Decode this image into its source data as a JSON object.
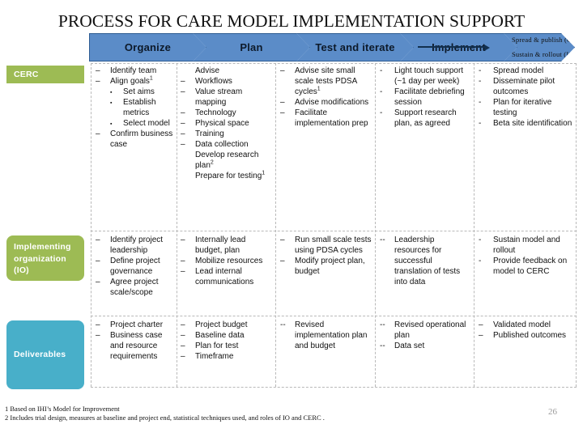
{
  "slide": {
    "title": "PROCESS FOR CARE MODEL IMPLEMENTATION SUPPORT",
    "page_number": "26"
  },
  "colors": {
    "chevron_fill": "#5b8cc8",
    "chevron_border": "#2f5d93",
    "row_green": "#9dbb54",
    "row_teal": "#48afc9",
    "separator": "#b9b9b9"
  },
  "phases": [
    {
      "label": "Organize"
    },
    {
      "label": "Plan"
    },
    {
      "label": "Test and iterate"
    },
    {
      "label": "Implement"
    },
    {
      "label_top": "Spread & publish (CERC)",
      "label_bottom": "Sustain & rollout (IO)"
    }
  ],
  "rows": [
    {
      "label": "CERC",
      "cells": [
        {
          "items": [
            {
              "marker": "–",
              "text": "Identify  team"
            },
            {
              "marker": "–",
              "text": "Align goals",
              "sup": "1"
            },
            {
              "marker": "▪",
              "level": 2,
              "text": "Set aims"
            },
            {
              "marker": "▪",
              "level": 2,
              "text": "Establish metrics"
            },
            {
              "marker": "▪",
              "level": 2,
              "text": "Select model"
            },
            {
              "marker": "–",
              "text": "Confirm business case"
            }
          ]
        },
        {
          "items": [
            {
              "marker": "",
              "level": 0,
              "text": "Advise"
            },
            {
              "marker": "–",
              "text": "Workflows"
            },
            {
              "marker": "–",
              "text": "Value stream mapping"
            },
            {
              "marker": "–",
              "text": "Technology"
            },
            {
              "marker": "–",
              "text": "Physical space"
            },
            {
              "marker": "–",
              "text": "Training"
            },
            {
              "marker": "–",
              "text": "Data collection"
            },
            {
              "marker": "",
              "level": 0,
              "text": "Develop research plan",
              "sup": "2"
            },
            {
              "marker": "",
              "level": 0,
              "text": "Prepare for testing",
              "sup": "1"
            }
          ]
        },
        {
          "items": [
            {
              "marker": "–",
              "text": "Advise site small scale tests  PDSA cycles",
              "sup": "1"
            },
            {
              "marker": "–",
              "text": "Advise modifications"
            },
            {
              "marker": "–",
              "text": "Facilitate implementation prep"
            }
          ]
        },
        {
          "items": [
            {
              "marker": "-",
              "text": "Light touch support (~1 day per week)"
            },
            {
              "marker": "-",
              "text": "Facilitate debriefing session"
            },
            {
              "marker": "-",
              "text": "Support research plan, as agreed"
            }
          ]
        },
        {
          "items": [
            {
              "marker": "-",
              "text": "Spread model"
            },
            {
              "marker": "-",
              "text": "Disseminate pilot outcomes"
            },
            {
              "marker": "-",
              "text": "Plan for iterative testing"
            },
            {
              "marker": "-",
              "text": "Beta site identification"
            }
          ]
        }
      ]
    },
    {
      "label": "Implementing organization (IO)",
      "cells": [
        {
          "items": [
            {
              "marker": "–",
              "text": "Identify project leadership"
            },
            {
              "marker": "–",
              "text": "Define project governance"
            },
            {
              "marker": "–",
              "text": "Agree project scale/scope"
            }
          ]
        },
        {
          "items": [
            {
              "marker": "–",
              "text": "Internally lead budget, plan"
            },
            {
              "marker": "–",
              "text": "Mobilize resources"
            },
            {
              "marker": "–",
              "text": "Lead internal communications"
            }
          ]
        },
        {
          "items": [
            {
              "marker": "–",
              "text": "Run small scale tests using PDSA cycles"
            },
            {
              "marker": "–",
              "text": "Modify project plan, budget"
            }
          ]
        },
        {
          "items": [
            {
              "marker": "--",
              "text": "Leadership resources for successful translation of tests into data"
            }
          ]
        },
        {
          "items": [
            {
              "marker": "-",
              "text": "Sustain model and rollout"
            },
            {
              "marker": "-",
              "text": "Provide feedback on model to CERC"
            }
          ]
        }
      ]
    },
    {
      "label": "Deliverables",
      "cells": [
        {
          "items": [
            {
              "marker": "–",
              "text": "Project charter"
            },
            {
              "marker": "–",
              "text": "Business case and resource requirements"
            }
          ]
        },
        {
          "items": [
            {
              "marker": "–",
              "text": "Project  budget"
            },
            {
              "marker": "–",
              "text": "Baseline data"
            },
            {
              "marker": "–",
              "text": "Plan for test"
            },
            {
              "marker": "–",
              "text": "Timeframe"
            }
          ]
        },
        {
          "items": [
            {
              "marker": "--",
              "text": "Revised implementation plan and budget"
            }
          ]
        },
        {
          "items": [
            {
              "marker": "--",
              "text": "Revised operational plan"
            },
            {
              "marker": "--",
              "text": "Data set"
            }
          ]
        },
        {
          "items": [
            {
              "marker": "–",
              "text": "Validated model"
            },
            {
              "marker": "–",
              "text": "Published outcomes"
            }
          ]
        }
      ]
    }
  ],
  "footnotes": [
    "1 Based on IHI’s Model for Improvement",
    "2 Includes trial design, measures at baseline and project end, statistical techniques used, and roles of IO and CERC ."
  ]
}
